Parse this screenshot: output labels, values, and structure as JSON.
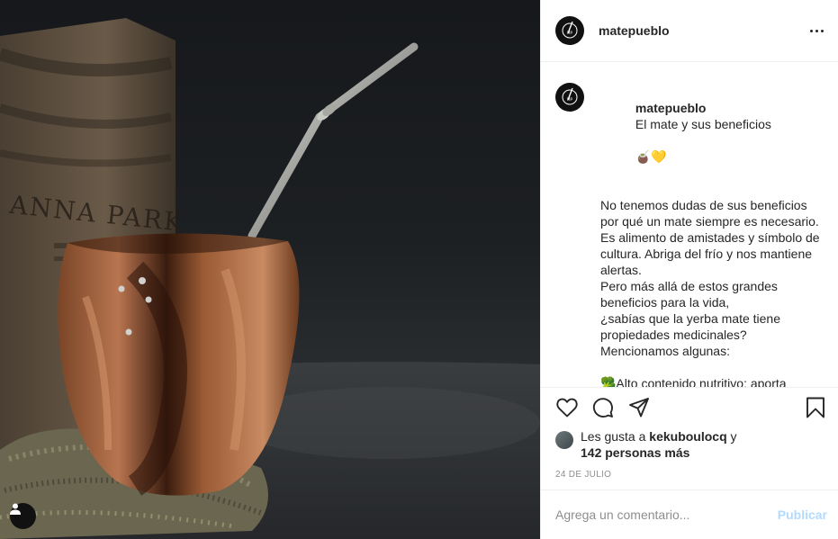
{
  "post": {
    "username": "matepueblo",
    "date": "24 DE JULIO",
    "caption": {
      "username": "matepueblo",
      "title": "El mate y sus beneficios",
      "title_emojis": "🧉💛",
      "body": "No tenemos dudas de sus beneficios por qué un mate siempre es necesario. Es alimento de amistades y símbolo de cultura. Abriga del frío y nos mantiene alertas.\nPero más allá de estos grandes beneficios para la vida,\n¿sabías que la yerba mate tiene propiedades medicinales?\nMencionamos algunas:\n\n🥦Alto contenido nutritivo: aporta vitaminas A, B, C y E, minerales (hierro, magnesio, sodio y potasio) y proteínas ya que posee doce aminoácidos esenciales."
    },
    "likes": {
      "prefix": "Les gusta a",
      "user": "kekuboulocq",
      "connector": "y",
      "others": "142 personas más"
    },
    "comment": {
      "placeholder": "Agrega un comentario...",
      "publish_label": "Publicar"
    },
    "photo_text": "ANNA PARK",
    "icons": {
      "header_avatar": "brand-logo-icon",
      "more": "more-options-icon",
      "like": "heart-icon",
      "comment": "comment-icon",
      "share": "share-icon",
      "save": "bookmark-icon",
      "tag": "user-tag-icon"
    },
    "colors": {
      "text": "#262626",
      "muted": "#8e8e8e",
      "publish": "#b3dbff",
      "border": "#efefef"
    }
  }
}
